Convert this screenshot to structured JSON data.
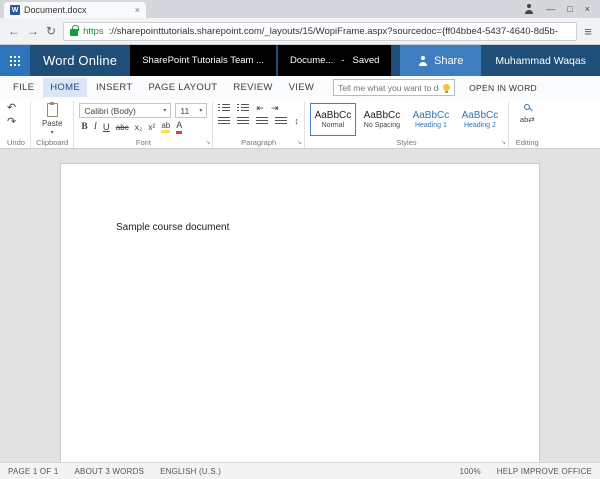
{
  "browser": {
    "tab_title": "Document.docx",
    "url_scheme": "https",
    "url_rest": "://sharepointtutorials.sharepoint.com/_layouts/15/WopiFrame.aspx?sourcedoc={ff04bbe4-5437-4640-8d5b-"
  },
  "icons": {
    "word_badge": "W",
    "tab_close": "×",
    "minimize": "—",
    "maximize": "□",
    "window_close": "×",
    "back": "←",
    "forward": "→",
    "refresh": "↻",
    "menu": "≡",
    "undo": "↶",
    "redo": "↷",
    "caret": "▾",
    "launcher": "↘",
    "bold": "B",
    "italic": "I",
    "underline": "U",
    "strikethrough": "abc",
    "subscript": "x₂",
    "superscript": "x²",
    "highlight": "ab",
    "font_color": "A",
    "indent_decrease": "⇤",
    "indent_increase": "⇥",
    "line_spacing": "↕",
    "replace": "ab⇄"
  },
  "suite_bar": {
    "app_name": "Word Online",
    "site_name": "SharePoint Tutorials Team ...",
    "doc_name": "Docume...",
    "separator": "-",
    "save_status": "Saved",
    "share_label": "Share",
    "user_name": "Muhammad Waqas"
  },
  "ribbon": {
    "tabs": [
      {
        "label": "FILE",
        "active": false
      },
      {
        "label": "HOME",
        "active": true
      },
      {
        "label": "INSERT",
        "active": false
      },
      {
        "label": "PAGE LAYOUT",
        "active": false
      },
      {
        "label": "REVIEW",
        "active": false
      },
      {
        "label": "VIEW",
        "active": false
      }
    ],
    "tell_me_placeholder": "Tell me what you want to do",
    "open_in_word": "OPEN IN WORD",
    "paste_label": "Paste",
    "font_family": "Calibri (Body)",
    "font_size": "11",
    "styles": [
      {
        "preview": "AaBbCc",
        "name": "Normal",
        "selected": true
      },
      {
        "preview": "AaBbCc",
        "name": "No Spacing",
        "selected": false
      },
      {
        "preview": "AaBbCc",
        "name": "Heading 1",
        "selected": false
      },
      {
        "preview": "AaBbCc",
        "name": "Heading 2",
        "selected": false
      }
    ],
    "groups": {
      "undo": "Undo",
      "clipboard": "Clipboard",
      "font": "Font",
      "paragraph": "Paragraph",
      "styles": "Styles",
      "editing": "Editing"
    }
  },
  "document": {
    "text": "Sample course document"
  },
  "status_bar": {
    "page": "PAGE 1 OF 1",
    "words": "ABOUT 3 WORDS",
    "language": "ENGLISH (U.S.)",
    "zoom": "100%",
    "help": "HELP IMPROVE OFFICE"
  },
  "colors": {
    "suite_bar": "#1f4e79",
    "app_launcher": "#2c75bb",
    "share_button": "#3e7dc0",
    "accent": "#2b579a",
    "heading_text": "#2e74b5",
    "selected_style_border": "#4a7fbf",
    "highlight_yellow": "#f7e04b",
    "font_color_red": "#d43f3f",
    "https_green": "#1a9b3e"
  }
}
